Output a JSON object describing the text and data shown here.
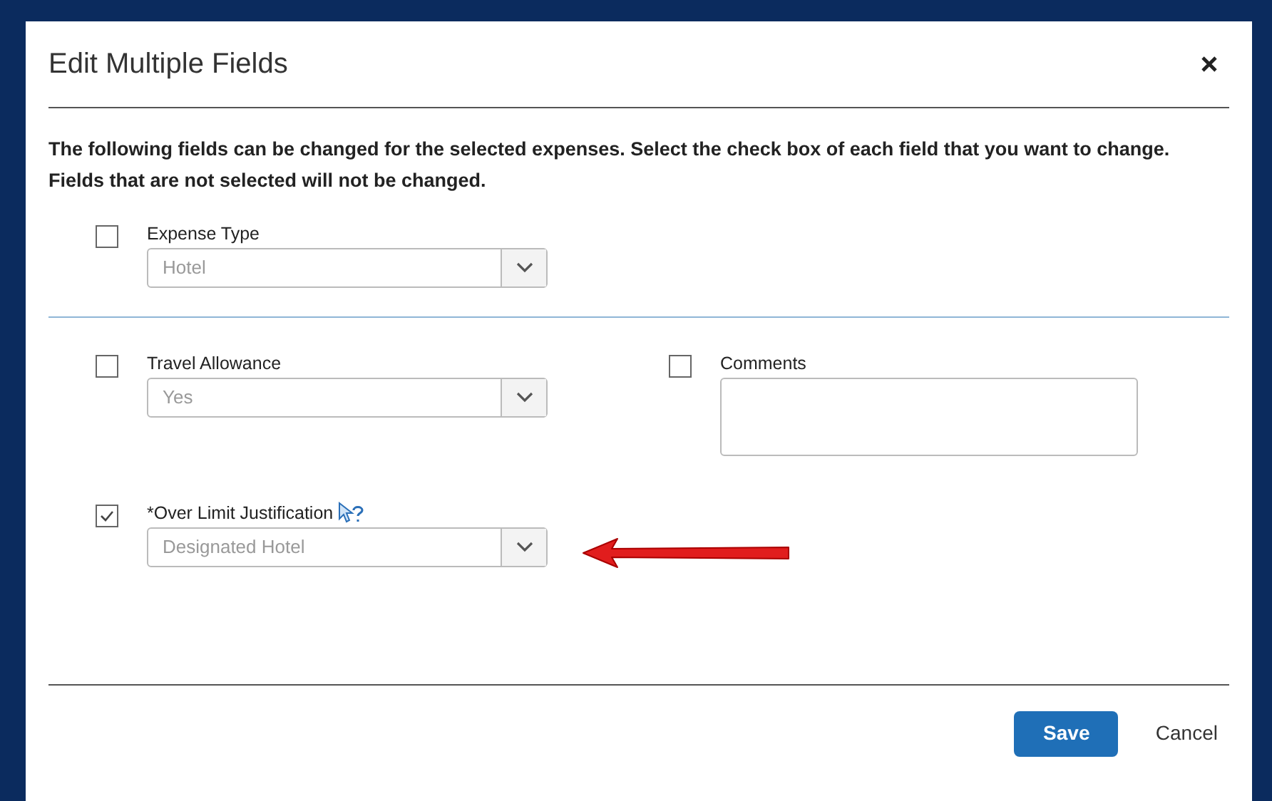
{
  "dialog": {
    "title": "Edit Multiple Fields",
    "intro": "The following fields can be changed for the selected expenses. Select the check box of each field that you want to change. Fields that are not selected will not be changed."
  },
  "rows": [
    {
      "kind": "fields",
      "fields": [
        {
          "kind": "select",
          "label": "Expense Type",
          "value": "Hotel",
          "checked": false
        }
      ]
    },
    {
      "kind": "divider"
    },
    {
      "kind": "fields",
      "fields": [
        {
          "kind": "select",
          "label": "Travel Allowance",
          "value": "Yes",
          "checked": false
        },
        {
          "kind": "textarea",
          "label": "Comments",
          "checked": false
        }
      ]
    },
    {
      "kind": "fields",
      "pointer_arrow": true,
      "fields": [
        {
          "kind": "select",
          "label": "*Over Limit Justification",
          "value": "Designated Hotel",
          "checked": true,
          "help": true
        }
      ]
    }
  ],
  "buttons": [
    {
      "label": "Save",
      "kind": "primary"
    },
    {
      "label": "Cancel",
      "kind": "link"
    }
  ]
}
